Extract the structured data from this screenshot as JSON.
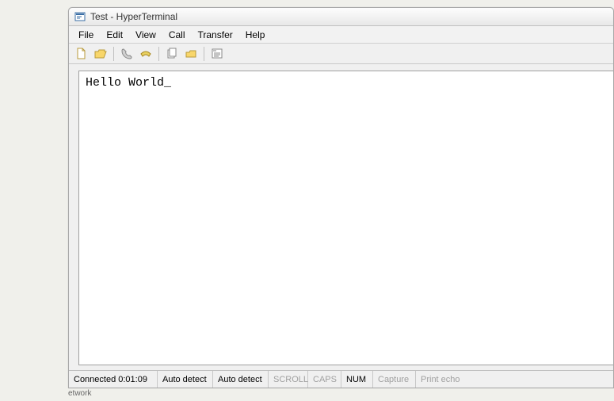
{
  "titlebar": {
    "title": "Test - HyperTerminal"
  },
  "menubar": {
    "items": [
      "File",
      "Edit",
      "View",
      "Call",
      "Transfer",
      "Help"
    ]
  },
  "toolbar": {
    "icons": [
      "new-file-icon",
      "open-file-icon",
      "call-icon",
      "hangup-icon",
      "send-icon",
      "receive-icon",
      "properties-icon"
    ]
  },
  "terminal": {
    "content": "Hello World_"
  },
  "statusbar": {
    "connection": "Connected 0:01:09",
    "detect1": "Auto detect",
    "detect2": "Auto detect",
    "scroll": "SCROLL",
    "caps": "CAPS",
    "num": "NUM",
    "capture": "Capture",
    "print_echo": "Print echo"
  },
  "below": "etwork"
}
